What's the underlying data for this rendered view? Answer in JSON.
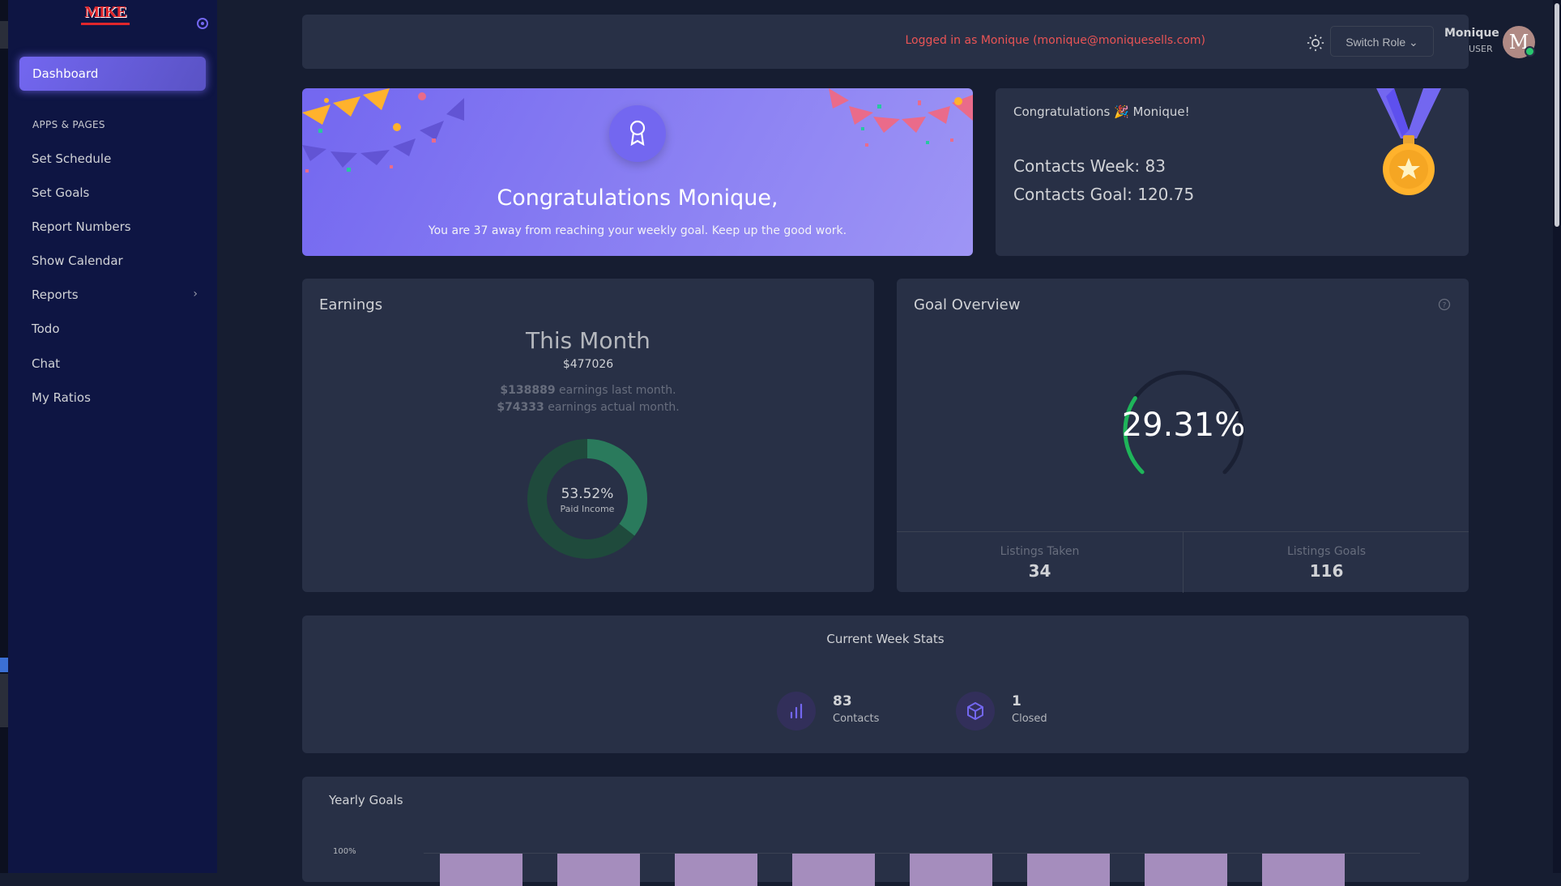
{
  "sidebar": {
    "logo_text": "MIKE",
    "active_item": "Dashboard",
    "section_header": "APPS & PAGES",
    "items": [
      {
        "label": "Set Schedule"
      },
      {
        "label": "Set Goals"
      },
      {
        "label": "Report Numbers"
      },
      {
        "label": "Show Calendar"
      },
      {
        "label": "Reports",
        "has_submenu": true
      },
      {
        "label": "Todo"
      },
      {
        "label": "Chat"
      },
      {
        "label": "My Ratios"
      }
    ]
  },
  "topbar": {
    "login_message": "Logged in as Monique (monique@moniquesells.com)",
    "switch_role_label": "Switch Role",
    "user_name": "Monique",
    "user_role": "USER",
    "avatar_initial": "M"
  },
  "congrats_banner": {
    "title": "Congratulations Monique,",
    "subtitle": "You are 37 away from reaching your weekly goal. Keep up the good work."
  },
  "medal_card": {
    "title": "Congratulations 🎉 Monique!",
    "contacts_week": "Contacts Week: 83",
    "contacts_goal": "Contacts Goal: 120.75"
  },
  "earnings": {
    "title": "Earnings",
    "period_label": "This Month",
    "amount": "$477026",
    "last_month_value": "$138889",
    "last_month_text": " earnings last month.",
    "actual_month_value": "$74333",
    "actual_month_text": " earnings actual month.",
    "donut_percent": "53.52%",
    "donut_label": "Paid Income",
    "donut_fraction": 0.3552
  },
  "goal_overview": {
    "title": "Goal Overview",
    "percent_text": "29.31%",
    "percent_value": 29.31,
    "listings_taken_label": "Listings Taken",
    "listings_taken_value": "34",
    "listings_goals_label": "Listings Goals",
    "listings_goals_value": "116"
  },
  "week_stats": {
    "title": "Current Week Stats",
    "contacts_value": "83",
    "contacts_label": "Contacts",
    "closed_value": "1",
    "closed_label": "Closed"
  },
  "yearly_goals": {
    "title": "Yearly Goals",
    "y_tick_top": "100%"
  },
  "colors": {
    "background": "#161d31",
    "sidebar": "#0e1543",
    "card": "#283046",
    "primary": "#7367f0",
    "danger": "#ea5455",
    "success": "#28c76f",
    "donut_dark": "#1f4a3c",
    "donut_light": "#2a7a5c",
    "bar": "#a58dbd"
  }
}
